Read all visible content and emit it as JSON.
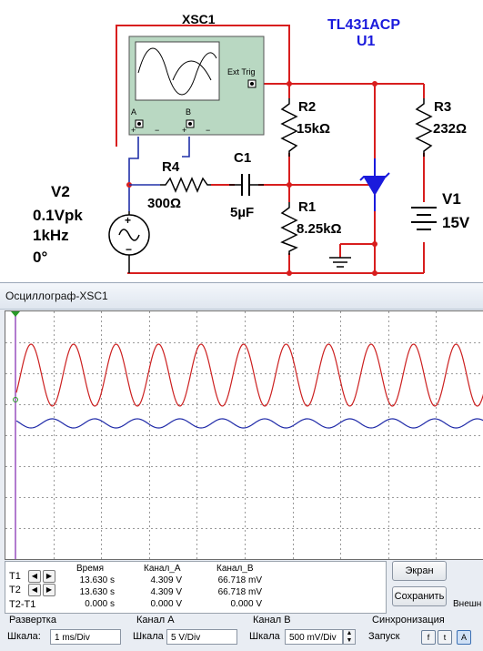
{
  "schematic": {
    "scope_name": "XSC1",
    "scope_terminal_a": "A",
    "scope_terminal_b": "B",
    "scope_ext_trig": "Ext Trig",
    "ic_part": "TL431ACP",
    "ic_ref": "U1",
    "r2_name": "R2",
    "r2_value": "15kΩ",
    "r3_name": "R3",
    "r3_value": "232Ω",
    "r4_name": "R4",
    "r4_value": "300Ω",
    "c1_name": "C1",
    "c1_value": "5µF",
    "r1_name": "R1",
    "r1_value": "8.25kΩ",
    "v1_name": "V1",
    "v1_value": "15V",
    "v2_name": "V2",
    "v2_amplitude": "0.1Vpk",
    "v2_freq": "1kHz",
    "v2_phase": "0°",
    "plus": "+",
    "minus": "−"
  },
  "scope": {
    "title": "Осциллограф-XSC1",
    "channel_a_color": "#cc1f1f",
    "channel_b_color": "#1f2aa8",
    "channel_a_cycles_visible": 11,
    "channel_b_cycles_visible": 11
  },
  "readout": {
    "col_time": "Время",
    "col_a": "Канал_A",
    "col_b": "Канал_B",
    "t1_label": "T1",
    "t2_label": "T2",
    "t2t1_label": "T2-T1",
    "t1": {
      "time": "13.630 s",
      "a": "4.309 V",
      "b": "66.718 mV"
    },
    "t2": {
      "time": "13.630 s",
      "a": "4.309 V",
      "b": "66.718 mV"
    },
    "t2t1": {
      "time": "0.000 s",
      "a": "0.000 V",
      "b": "0.000 V"
    },
    "left_arrow": "◀",
    "right_arrow": "▶"
  },
  "buttons": {
    "screen": "Экран",
    "save": "Сохранить",
    "external": "Внешн"
  },
  "controls": {
    "timebase_title": "Развертка",
    "timebase_scale_label": "Шкала:",
    "timebase_scale": "1 ms/Div",
    "cha_title": "Канал A",
    "cha_scale_label": "Шкала",
    "cha_scale": "5 V/Div",
    "chb_title": "Канал B",
    "chb_scale_label": "Шкала",
    "chb_scale": "500 mV/Div",
    "sync_title": "Синхронизация",
    "sync_start_label": "Запуск",
    "sync_rise": "f",
    "sync_fall": "t",
    "sync_a": "A"
  }
}
